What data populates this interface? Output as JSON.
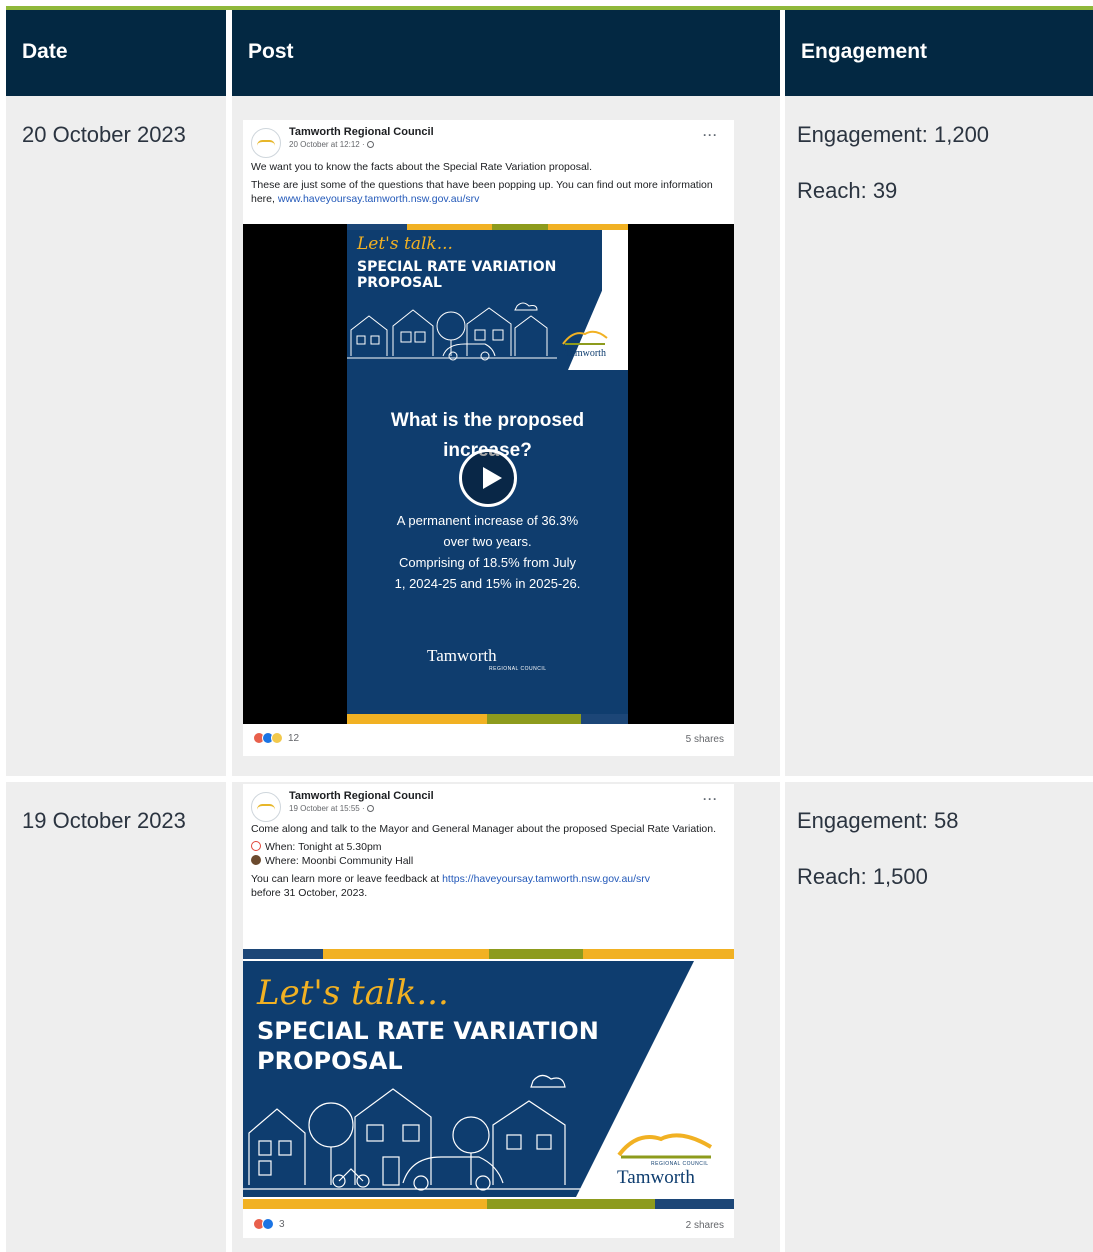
{
  "header": {
    "date": "Date",
    "post": "Post",
    "engagement": "Engagement"
  },
  "rows": [
    {
      "date": "20 October 2023",
      "engagement": "Engagement: 1,200",
      "reach": "Reach: 39",
      "post": {
        "page_name": "Tamworth Regional Council",
        "time": "20 October at 12:12 ·",
        "more": "···",
        "text_1": "We want you to know the facts about the Special Rate Variation proposal.",
        "text_2": "These are just some of the questions that have been popping up. You can find out more information here,",
        "link": "www.haveyoursay.tamworth.nsw.gov.au/srv",
        "video": {
          "lets_talk": "Let's talk...",
          "title_line1": "SPECIAL RATE VARIATION",
          "title_line2": "PROPOSAL",
          "logo_name": "Tamworth",
          "question": "What is the proposed increase?",
          "answer_1": "A permanent increase of 36.3%",
          "answer_2": "over two years.",
          "answer_3": "Comprising of 18.5% from July",
          "answer_4": "1, 2024-25 and 15% in 2025-26.",
          "footer_logo": "Tamworth",
          "footer_logo_sub": "REGIONAL COUNCIL"
        },
        "reactions_count": "12",
        "shares": "5 shares"
      }
    },
    {
      "date": "19 October 2023",
      "engagement": "Engagement: 58",
      "reach": "Reach: 1,500",
      "post": {
        "page_name": "Tamworth Regional Council",
        "time": "19 October at 15:55 ·",
        "more": "···",
        "text_1": "Come along and talk to the Mayor and General Manager about the proposed Special Rate Variation.",
        "when": "When: Tonight at 5.30pm",
        "where": "Where: Moonbi Community Hall",
        "text_2": "You can learn more or leave feedback at",
        "link": "https://haveyoursay.tamworth.nsw.gov.au/srv",
        "text_3": "before 31 October, 2023.",
        "banner": {
          "lets_talk": "Let's talk...",
          "title_line1": "SPECIAL RATE VARIATION",
          "title_line2": "PROPOSAL",
          "logo_name": "Tamworth",
          "logo_sub": "REGIONAL COUNCIL"
        },
        "reactions_count": "3",
        "shares": "2 shares"
      }
    }
  ],
  "colors": {
    "header_bg": "#032842",
    "accent_green": "#8fb83a",
    "cell_bg": "#eeeeee",
    "brand_navy": "#0e3d6f",
    "brand_yellow": "#f1b123"
  }
}
